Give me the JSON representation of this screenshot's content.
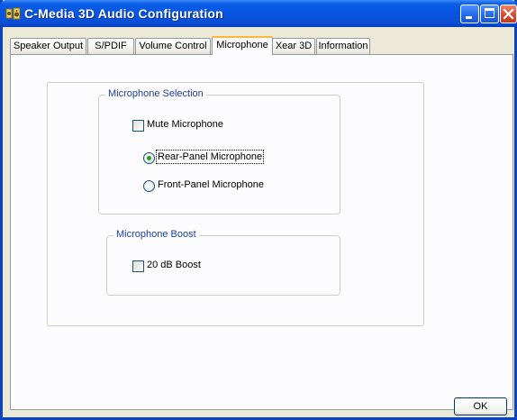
{
  "window": {
    "title": "C-Media 3D Audio Configuration",
    "icon": "speaker-app-icon",
    "controls": [
      "minimize-icon",
      "maximize-icon",
      "close-icon"
    ]
  },
  "tabs": [
    {
      "label": "Speaker Output",
      "active": false
    },
    {
      "label": "S/PDIF",
      "active": false
    },
    {
      "label": "Volume Control",
      "active": false
    },
    {
      "label": "Microphone",
      "active": true
    },
    {
      "label": "Xear 3D",
      "active": false
    },
    {
      "label": "Information",
      "active": false
    }
  ],
  "mic_selection": {
    "legend": "Microphone Selection",
    "mute_label": "Mute Microphone",
    "mute_checked": false,
    "rear_label": "Rear-Panel Microphone",
    "rear_selected": true,
    "front_label": "Front-Panel Microphone",
    "front_selected": false
  },
  "mic_boost": {
    "legend": "Microphone Boost",
    "boost_label": "20 dB Boost",
    "boost_checked": false
  },
  "footer": {
    "ok_label": "OK"
  },
  "colors": {
    "title_bar": "#0854e0",
    "active_tab_accent": "#f8b83a",
    "group_legend": "#1c3f9e",
    "radio_dot": "#21a121",
    "close_button": "#d9452a"
  }
}
